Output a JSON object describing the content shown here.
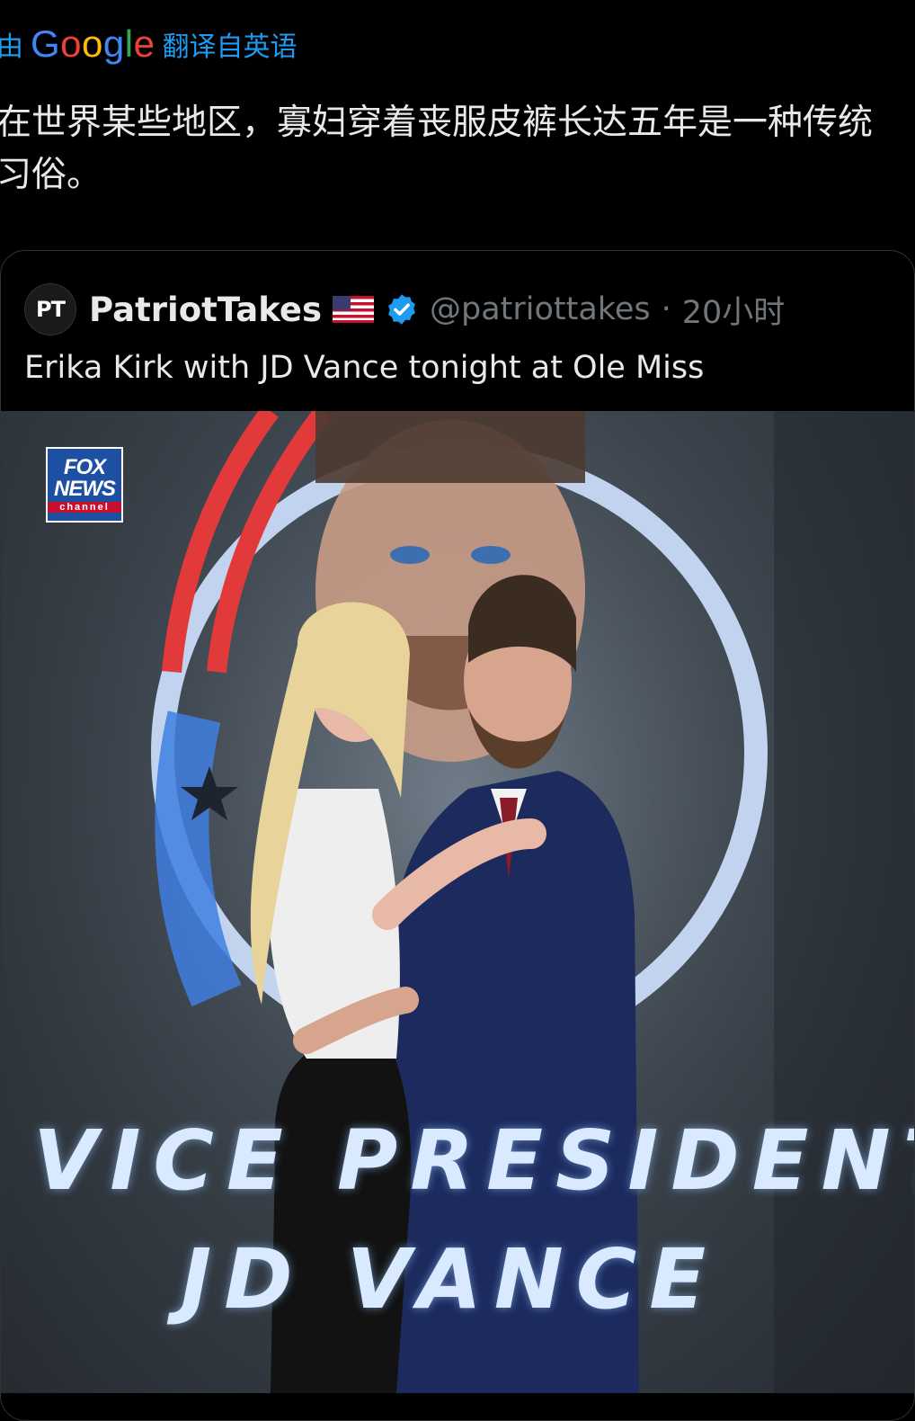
{
  "translation_bar": {
    "prefix": "由",
    "google": [
      "G",
      "o",
      "o",
      "g",
      "l",
      "e"
    ],
    "label": "翻译自英语"
  },
  "translated_text": "在世界某些地区，寡妇穿着丧服皮裤长达五年是一种传统\n习俗。",
  "quote": {
    "avatar_text": "PT",
    "display_name": "PatriotTakes",
    "handle": "@patriottakes",
    "separator": "·",
    "time": "20小时",
    "text": "Erika Kirk with JD Vance tonight at Ole Miss"
  },
  "photo": {
    "logo_lines": [
      "FOX",
      "NEWS"
    ],
    "logo_channel": "channel",
    "banner_line_1": "VICE PRESIDENT",
    "banner_line_2": "JD VANCE"
  },
  "colors": {
    "background": "#000000",
    "link_blue": "#1d9bf0",
    "text": "#e7e9ea",
    "muted": "#71767b",
    "verified": "#1d9bf0"
  },
  "icons": [
    "google-logo",
    "flag-us-icon",
    "verified-badge-icon",
    "fox-news-logo"
  ]
}
